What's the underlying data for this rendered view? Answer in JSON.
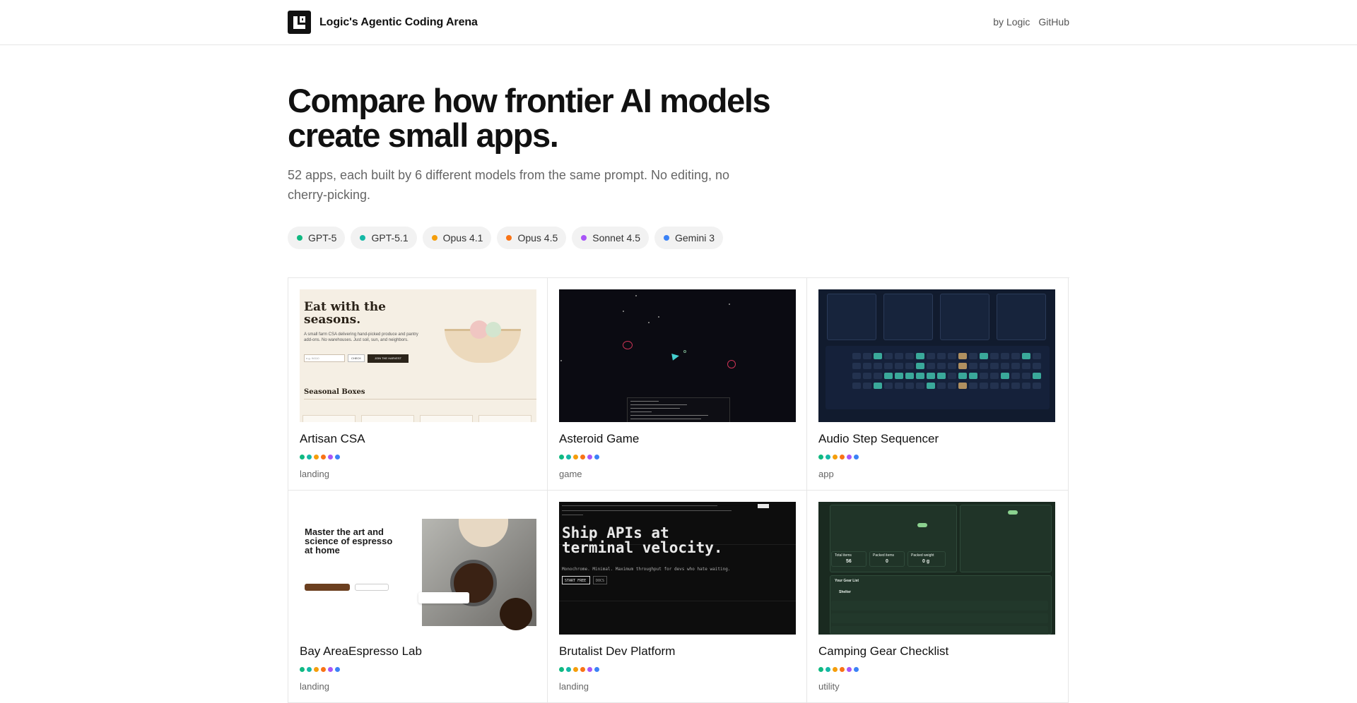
{
  "header": {
    "title": "Logic's Agentic Coding Arena",
    "nav": [
      {
        "label": "by Logic"
      },
      {
        "label": "GitHub"
      }
    ]
  },
  "hero": {
    "heading": "Compare how frontier AI models create small apps.",
    "subheading": "52 apps, each built by 6 different models from the same prompt. No editing, no cherry-picking."
  },
  "models": [
    {
      "label": "GPT-5",
      "color": "#10b981"
    },
    {
      "label": "GPT-5.1",
      "color": "#14b8a6"
    },
    {
      "label": "Opus 4.1",
      "color": "#f59e0b"
    },
    {
      "label": "Opus 4.5",
      "color": "#f97316"
    },
    {
      "label": "Sonnet 4.5",
      "color": "#a855f7"
    },
    {
      "label": "Gemini 3",
      "color": "#3b82f6"
    }
  ],
  "apps": [
    {
      "title": "Artisan CSA",
      "category": "landing",
      "preview": {
        "heading": "Eat with the seasons.",
        "text": "A small farm CSA delivering hand-picked produce and pantry add-ons. No warehouses. Just soil, sun, and neighbors.",
        "input_placeholder": "e.g. 94110",
        "check_label": "CHECK",
        "cta_label": "JOIN THE HARVEST",
        "section_title": "Seasonal Boxes"
      }
    },
    {
      "title": "Asteroid Game",
      "category": "game"
    },
    {
      "title": "Audio Step Sequencer",
      "category": "app"
    },
    {
      "title": "Bay AreaEspresso Lab",
      "category": "landing",
      "preview": {
        "heading": "Master the art and science of espresso at home"
      }
    },
    {
      "title": "Brutalist Dev Platform",
      "category": "landing",
      "preview": {
        "heading": "Ship APIs at terminal velocity.",
        "text": "Monochrome. Minimal. Maximum throughput for devs who hate waiting.",
        "cta_label": "START FREE",
        "secondary_label": "DOCS"
      }
    },
    {
      "title": "Camping Gear Checklist",
      "category": "utility",
      "preview": {
        "total_items_label": "Total items",
        "total_items": "56",
        "packed_items_label": "Packed items",
        "packed_items": "0",
        "packed_weight_label": "Packed weight",
        "packed_weight": "0 g",
        "list_title": "Your Gear List",
        "group_title": "Shelter"
      }
    }
  ]
}
